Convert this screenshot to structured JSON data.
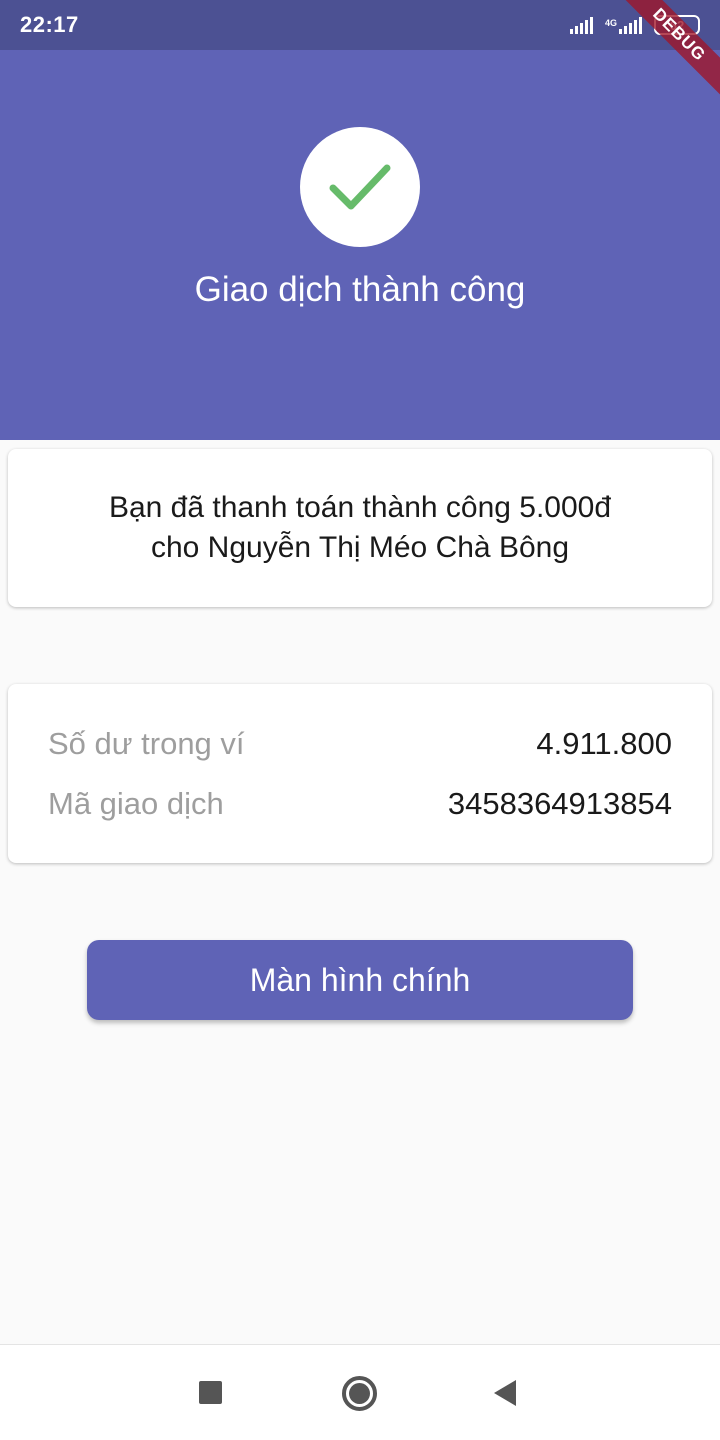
{
  "status_bar": {
    "time": "22:17",
    "network": "4G",
    "battery": "62"
  },
  "debug_banner": "DEBUG",
  "header": {
    "icon": "check-icon",
    "title": "Giao dịch thành công",
    "background_color": "#5f63b6",
    "check_color": "#66bb6a"
  },
  "message": {
    "line1": "Bạn đã thanh toán thành công 5.000đ",
    "line2": "cho Nguyễn Thị Méo Chà Bông"
  },
  "info": {
    "rows": [
      {
        "label": "Số dư trong ví",
        "value": "4.911.800"
      },
      {
        "label": "Mã giao dịch",
        "value": "3458364913854"
      }
    ]
  },
  "actions": {
    "home_button": "Màn hình chính"
  },
  "nav_bar": {
    "icons": [
      "recents-square-icon",
      "home-circle-icon",
      "back-triangle-icon"
    ]
  }
}
